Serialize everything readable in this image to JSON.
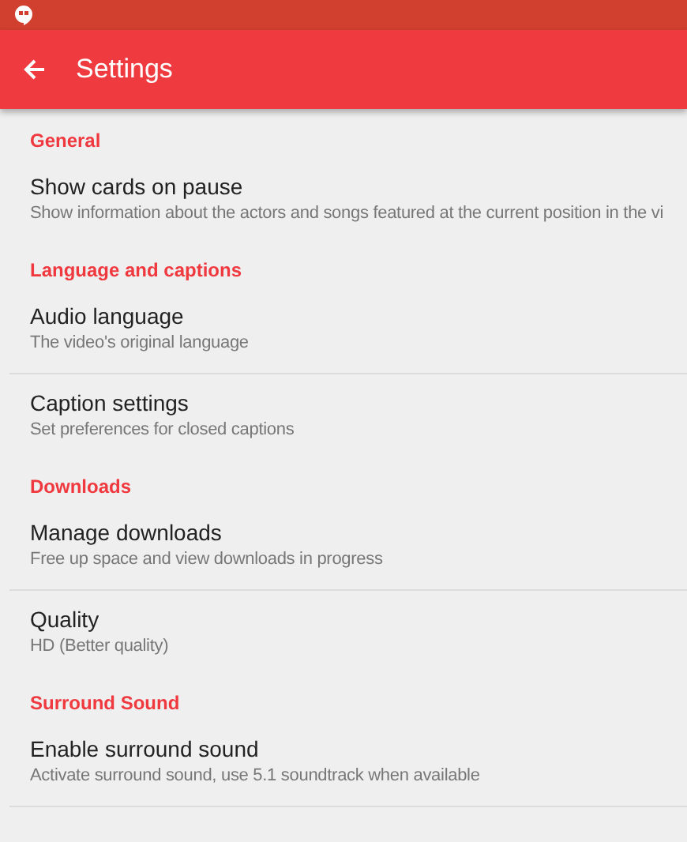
{
  "app_bar": {
    "title": "Settings"
  },
  "sections": [
    {
      "heading": "General",
      "items": [
        {
          "title": "Show cards on pause",
          "subtitle": "Show information about the actors and songs featured at the current position in the vi"
        }
      ]
    },
    {
      "heading": "Language and captions",
      "items": [
        {
          "title": "Audio language",
          "subtitle": "The video's original language"
        },
        {
          "title": "Caption settings",
          "subtitle": "Set preferences for closed captions"
        }
      ]
    },
    {
      "heading": "Downloads",
      "items": [
        {
          "title": "Manage downloads",
          "subtitle": "Free up space and view downloads in progress"
        },
        {
          "title": "Quality",
          "subtitle": "HD (Better quality)"
        }
      ]
    },
    {
      "heading": "Surround Sound",
      "items": [
        {
          "title": "Enable surround sound",
          "subtitle": "Activate surround sound, use 5.1 soundtrack when available"
        }
      ]
    }
  ]
}
